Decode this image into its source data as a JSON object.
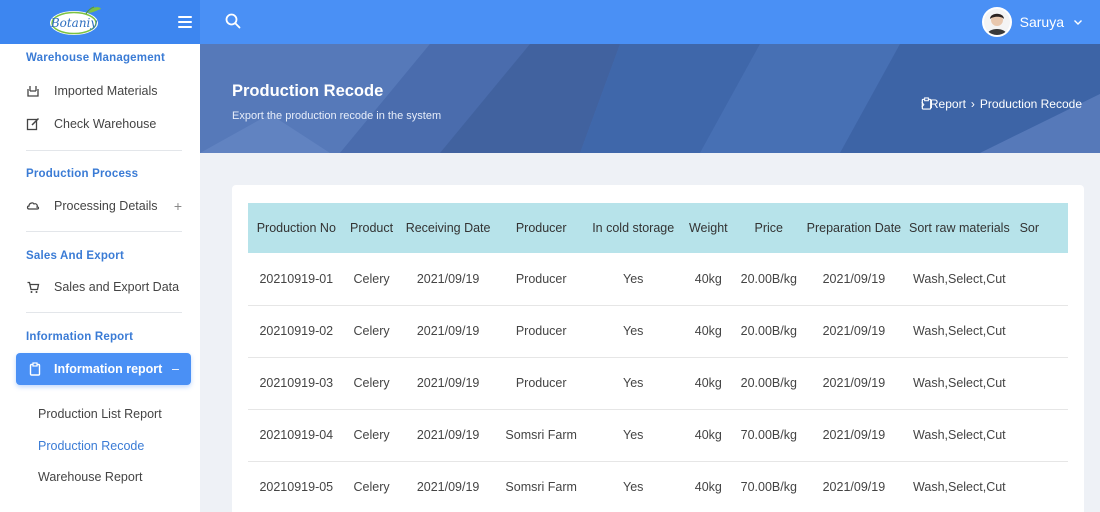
{
  "app": {
    "logo_text": "Botaniy",
    "username": "Saruya"
  },
  "sidebar": {
    "sections": [
      {
        "title": "Warehouse Management",
        "items": [
          {
            "label": "Imported Materials",
            "icon": "box-icon"
          },
          {
            "label": "Check Warehouse",
            "icon": "edit-icon"
          }
        ]
      },
      {
        "title": "Production Process",
        "items": [
          {
            "label": "Processing Details",
            "icon": "cloud-icon",
            "expand": "+"
          }
        ]
      },
      {
        "title": "Sales And Export",
        "items": [
          {
            "label": "Sales and Export Data",
            "icon": "cart-icon"
          }
        ]
      },
      {
        "title": "Information Report",
        "active_item": {
          "label": "Information report",
          "icon": "clipboard-icon",
          "collapse": "–"
        },
        "sub_items": [
          "Production List Report",
          "Production Recode",
          "Warehouse Report"
        ]
      }
    ]
  },
  "banner": {
    "title": "Production Recode",
    "subtitle": "Export the production recode in the system",
    "breadcrumb": [
      "Report",
      "Production Recode"
    ],
    "separator": "›"
  },
  "table": {
    "headers": [
      "Production No",
      "Product",
      "Receiving Date",
      "Producer",
      "In cold storage",
      "Weight",
      "Price",
      "Preparation Date",
      "Sort raw materials",
      "Sor"
    ],
    "rows": [
      [
        "20210919-01",
        "Celery",
        "2021/09/19",
        "Producer",
        "Yes",
        "40kg",
        "20.00B/kg",
        "2021/09/19",
        "Wash,Select,Cut",
        ""
      ],
      [
        "20210919-02",
        "Celery",
        "2021/09/19",
        "Producer",
        "Yes",
        "40kg",
        "20.00B/kg",
        "2021/09/19",
        "Wash,Select,Cut",
        ""
      ],
      [
        "20210919-03",
        "Celery",
        "2021/09/19",
        "Producer",
        "Yes",
        "40kg",
        "20.00B/kg",
        "2021/09/19",
        "Wash,Select,Cut",
        ""
      ],
      [
        "20210919-04",
        "Celery",
        "2021/09/19",
        "Somsri Farm",
        "Yes",
        "40kg",
        "70.00B/kg",
        "2021/09/19",
        "Wash,Select,Cut",
        ""
      ],
      [
        "20210919-05",
        "Celery",
        "2021/09/19",
        "Somsri Farm",
        "Yes",
        "40kg",
        "70.00B/kg",
        "2021/09/19",
        "Wash,Select,Cut",
        ""
      ]
    ]
  },
  "colors": {
    "accent": "#4a90f5",
    "section_title": "#3a7bd5",
    "banner": "#4b6fb0",
    "table_header": "#b7e3ea"
  }
}
